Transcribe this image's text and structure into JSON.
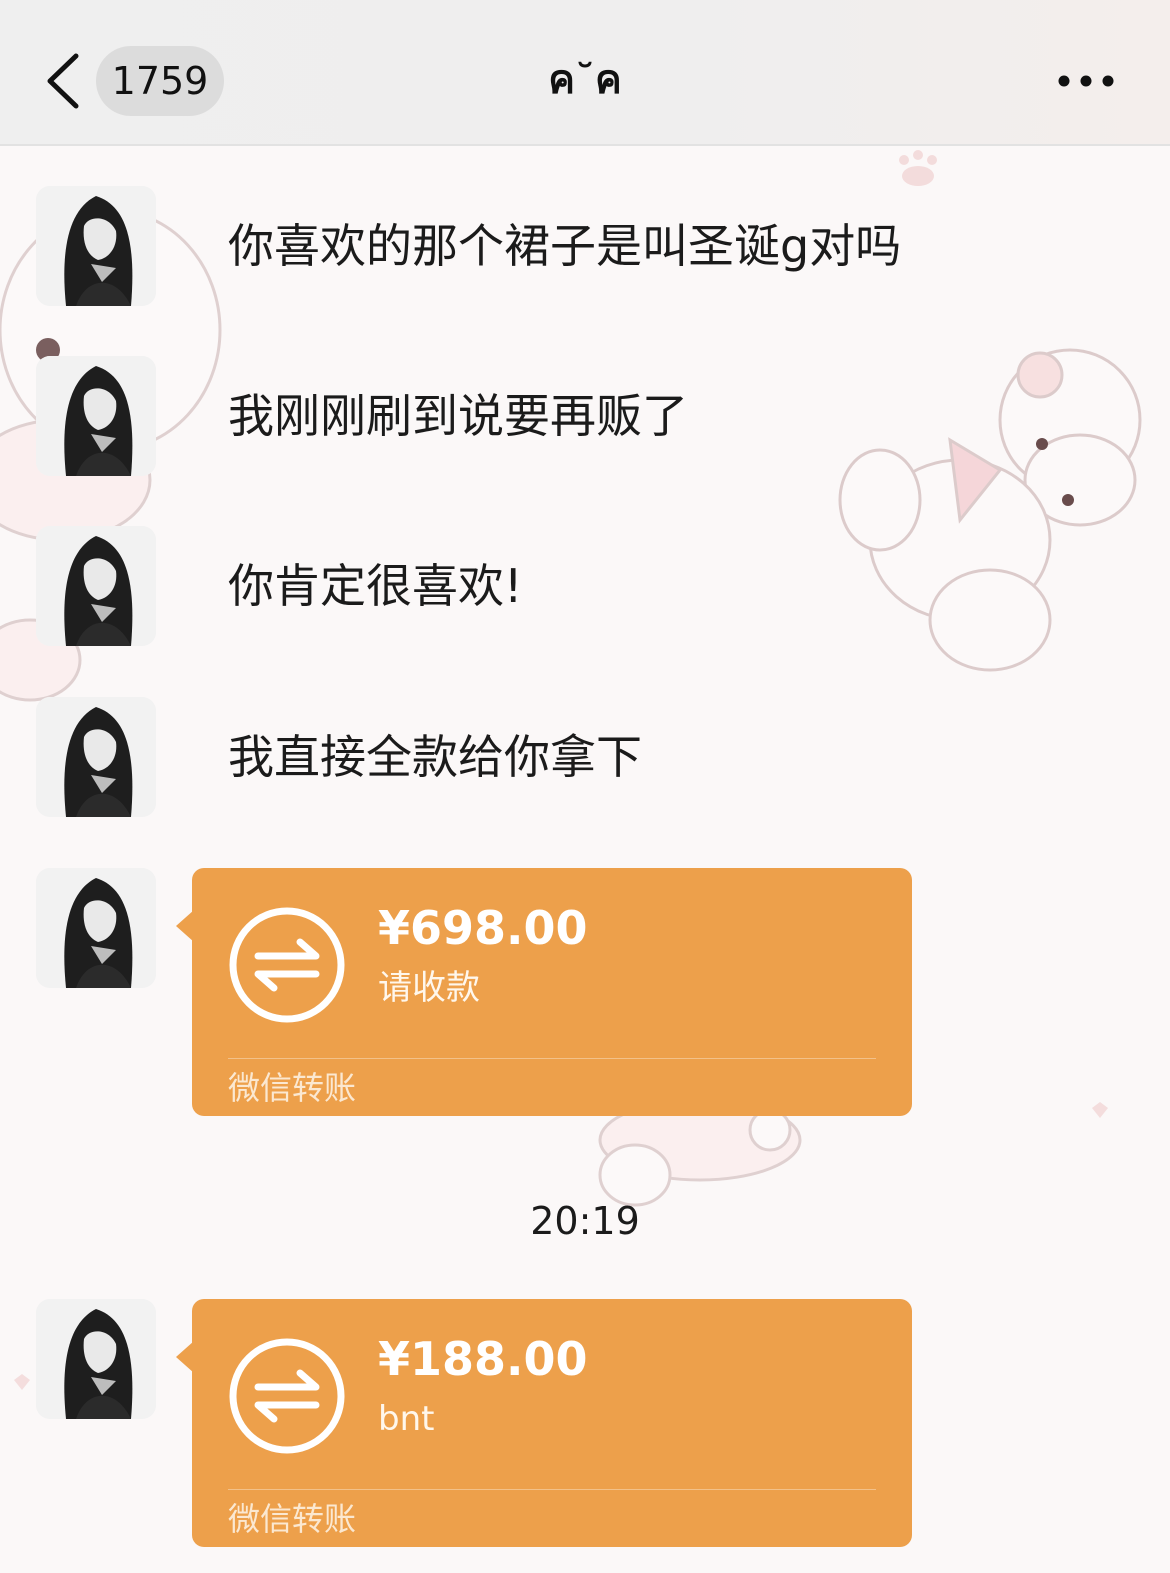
{
  "header": {
    "unread_count": "1759",
    "title": "ค˘ค"
  },
  "messages": [
    {
      "type": "text",
      "text": "你喜欢的那个裙子是叫圣诞g对吗"
    },
    {
      "type": "text",
      "text": "我刚刚刷到说要再贩了"
    },
    {
      "type": "text",
      "text": "你肯定很喜欢!"
    },
    {
      "type": "text",
      "text": "我直接全款给你拿下"
    },
    {
      "type": "transfer",
      "amount": "¥698.00",
      "note": "请收款",
      "label": "微信转账"
    },
    {
      "type": "transfer",
      "amount": "¥188.00",
      "note": "bnt",
      "label": "微信转账"
    }
  ],
  "timestamp": "20:19",
  "colors": {
    "transfer_bg": "#eda04b",
    "header_bg": "#efefef",
    "badge_bg": "#dcdcdc"
  },
  "icons": {
    "back": "chevron-left-icon",
    "more": "more-dots-icon",
    "transfer": "transfer-arrows-icon",
    "decoration": "teddy-bear-icon"
  }
}
